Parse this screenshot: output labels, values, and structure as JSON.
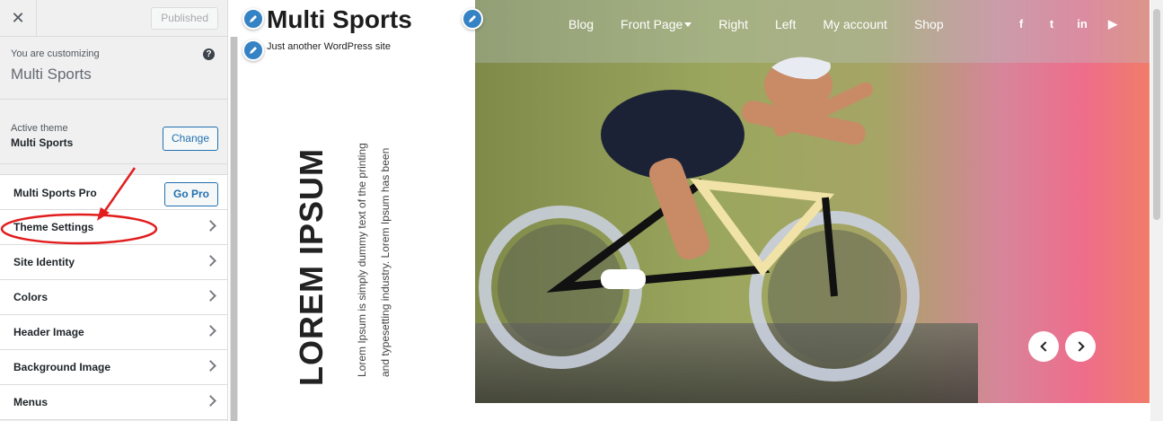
{
  "sidebar": {
    "close_icon": "close-icon",
    "published_label": "Published",
    "customizing_label": "You are customizing",
    "site_name": "Multi Sports",
    "help_icon": "help-icon",
    "active_theme_label": "Active theme",
    "active_theme_name": "Multi Sports",
    "change_label": "Change",
    "pro_label": "Multi Sports Pro",
    "go_pro_label": "Go Pro",
    "items": [
      {
        "label": "Theme Settings"
      },
      {
        "label": "Site Identity"
      },
      {
        "label": "Colors"
      },
      {
        "label": "Header Image"
      },
      {
        "label": "Background Image"
      },
      {
        "label": "Menus"
      }
    ]
  },
  "annotation": {
    "color": "#e11d1d",
    "target": "Theme Settings"
  },
  "preview": {
    "site_title": "Multi Sports",
    "tagline": "Just another WordPress site",
    "nav": [
      {
        "label": "Blog"
      },
      {
        "label": "Front Page"
      },
      {
        "label": "Right"
      },
      {
        "label": "Left"
      },
      {
        "label": "My account"
      },
      {
        "label": "Shop"
      }
    ],
    "social": [
      {
        "icon": "facebook-icon",
        "glyph": "f"
      },
      {
        "icon": "twitter-icon",
        "glyph": "t"
      },
      {
        "icon": "linkedin-icon",
        "glyph": "in"
      },
      {
        "icon": "youtube-icon",
        "glyph": "▶"
      }
    ],
    "slide_title": "LOREM IPSUM",
    "slide_text": "Lorem Ipsum is simply dummy text of the printing and typesetting industry. Lorem Ipsum has been",
    "prev_icon": "chevron-left-icon",
    "next_icon": "chevron-right-icon"
  },
  "colors": {
    "accent": "#2271b1",
    "pencil": "#3582c4",
    "hero_gradient_end": "#ef6a84"
  }
}
